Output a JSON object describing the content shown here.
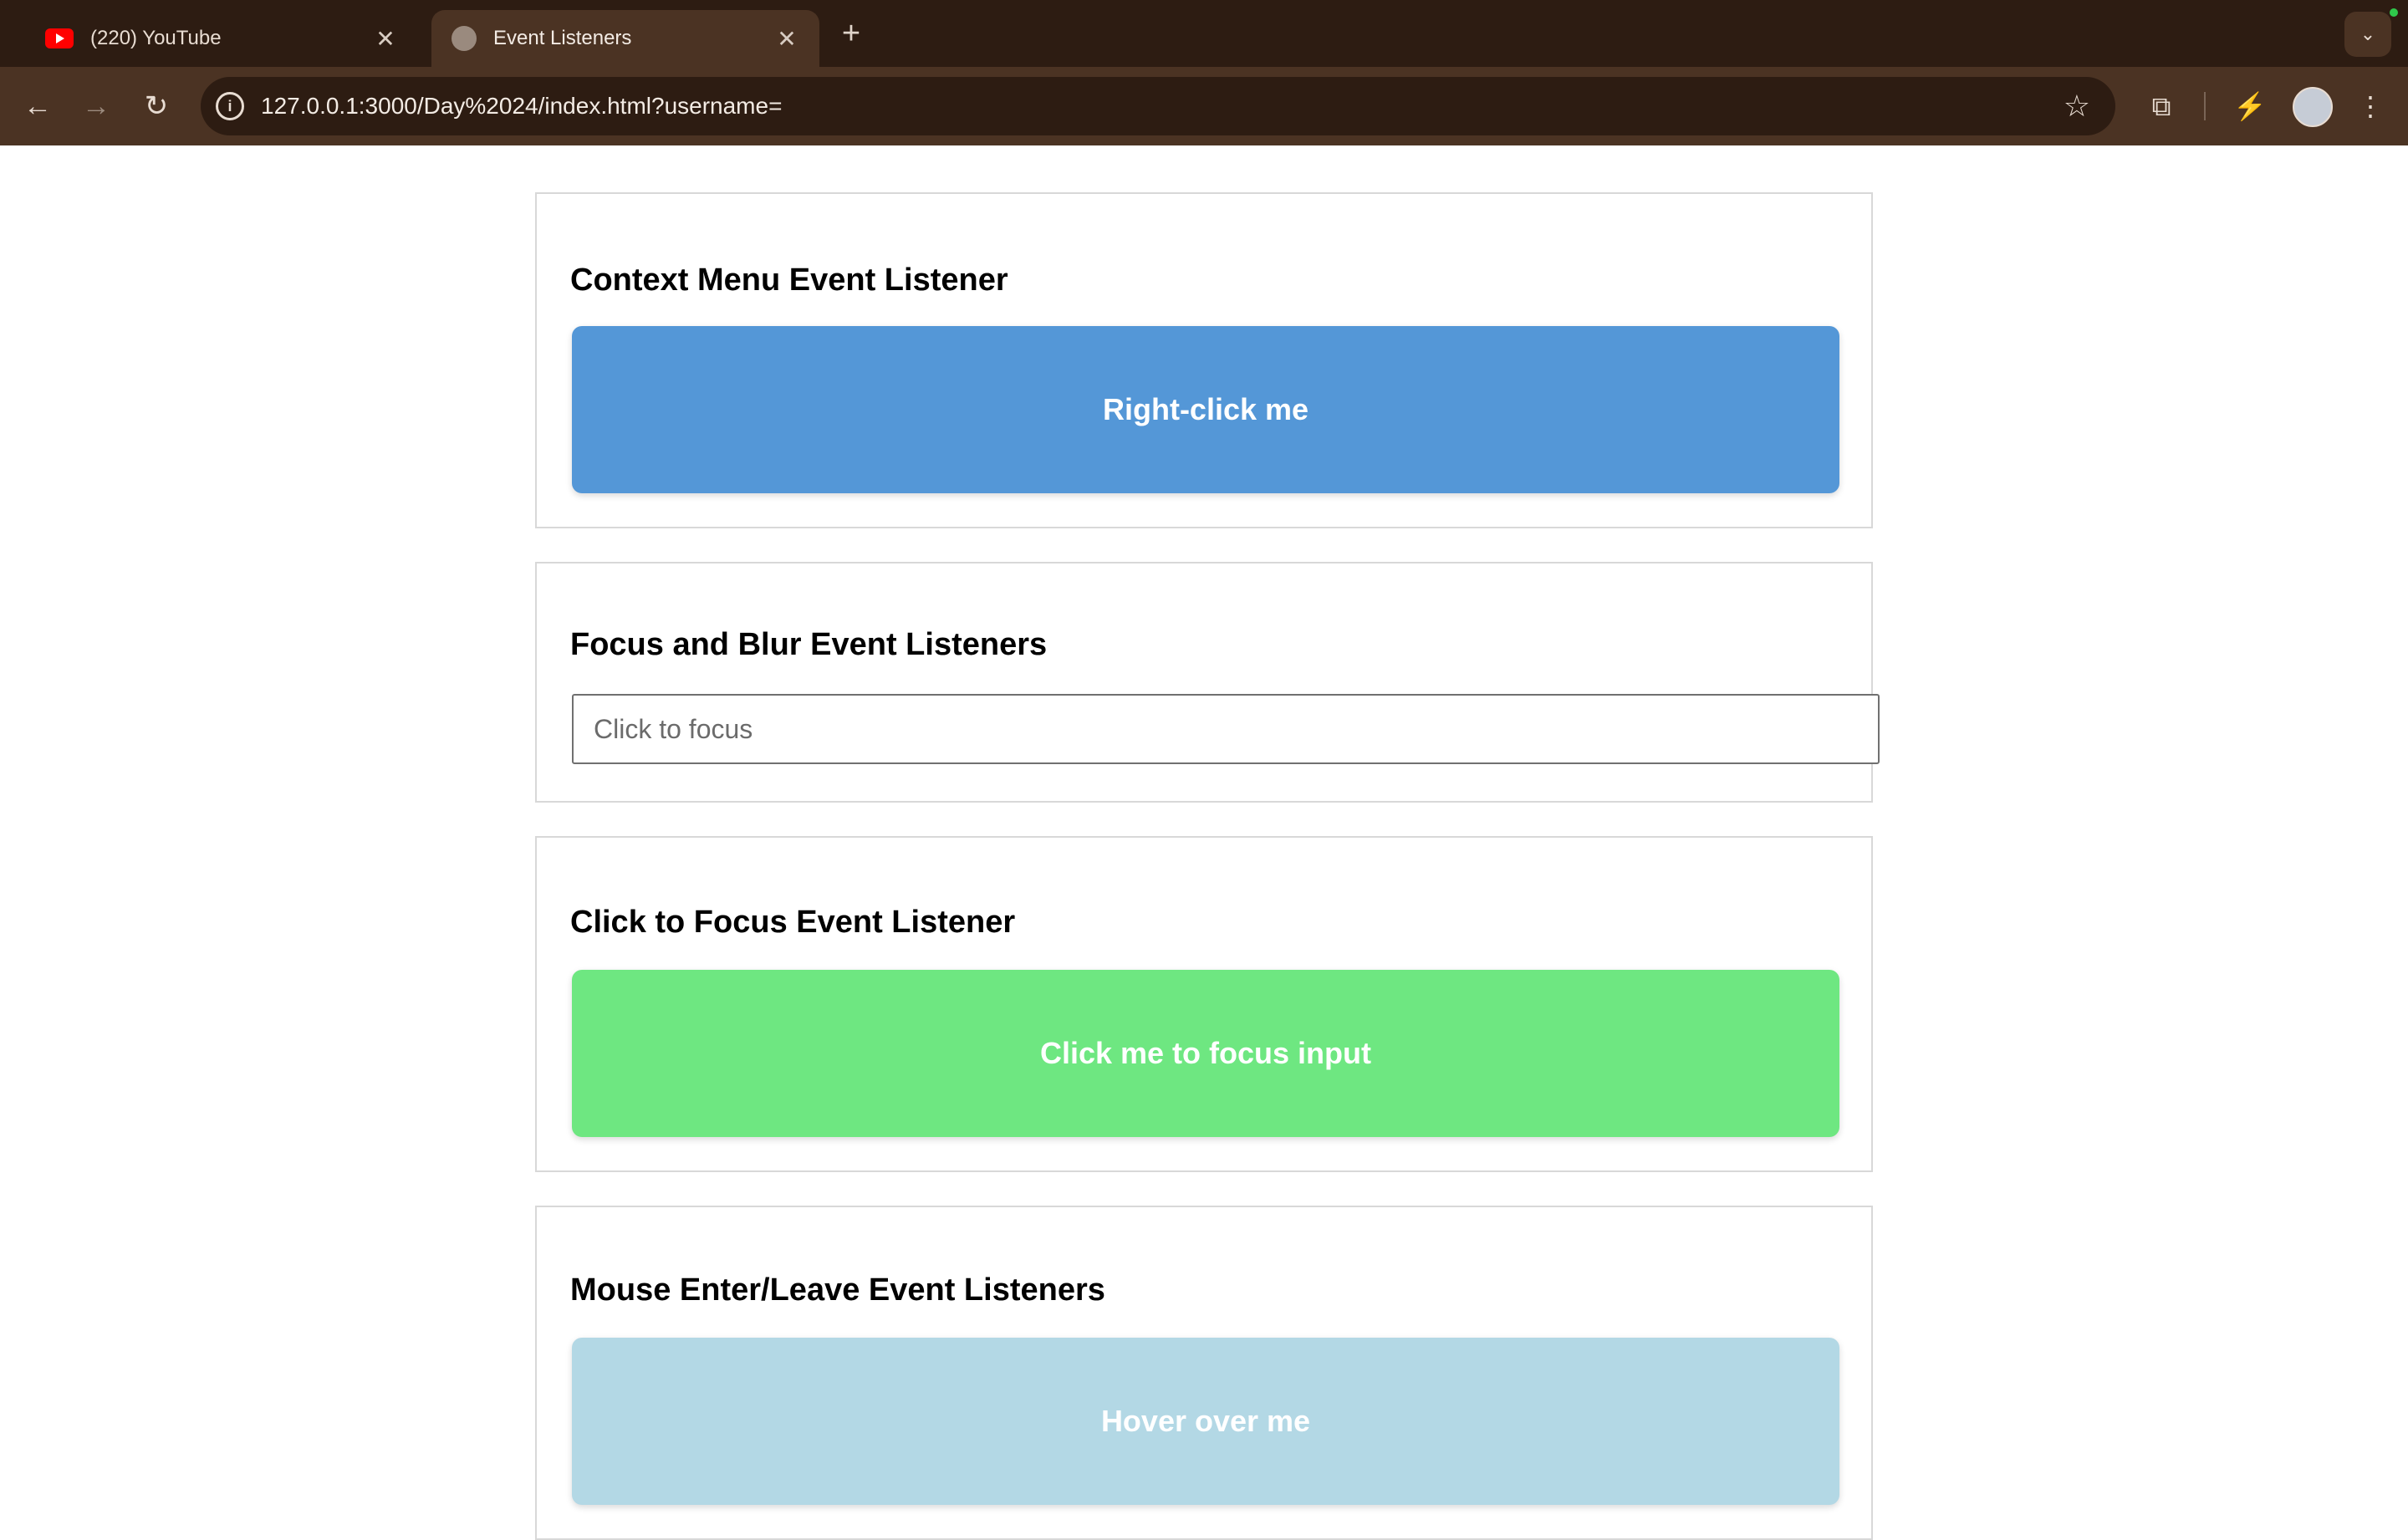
{
  "browser": {
    "tabs": [
      {
        "title": "(220) YouTube",
        "icon": "youtube-icon",
        "active": false
      },
      {
        "title": "Event Listeners",
        "icon": "globe-icon",
        "active": true
      }
    ],
    "new_tab_label": "+",
    "url": "127.0.0.1:3000/Day%2024/index.html?username="
  },
  "sections": {
    "context_menu": {
      "heading": "Context Menu Event Listener",
      "button_label": "Right-click me",
      "color": "#5497d7"
    },
    "focus_blur": {
      "heading": "Focus and Blur Event Listeners",
      "input_value": "",
      "input_placeholder": "Click to focus"
    },
    "click_focus": {
      "heading": "Click to Focus Event Listener",
      "button_label": "Click me to focus input",
      "color": "#6ee781"
    },
    "mouse_enter_leave": {
      "heading": "Mouse Enter/Leave Event Listeners",
      "box_label": "Hover over me",
      "color": "#b3d8e5"
    }
  }
}
